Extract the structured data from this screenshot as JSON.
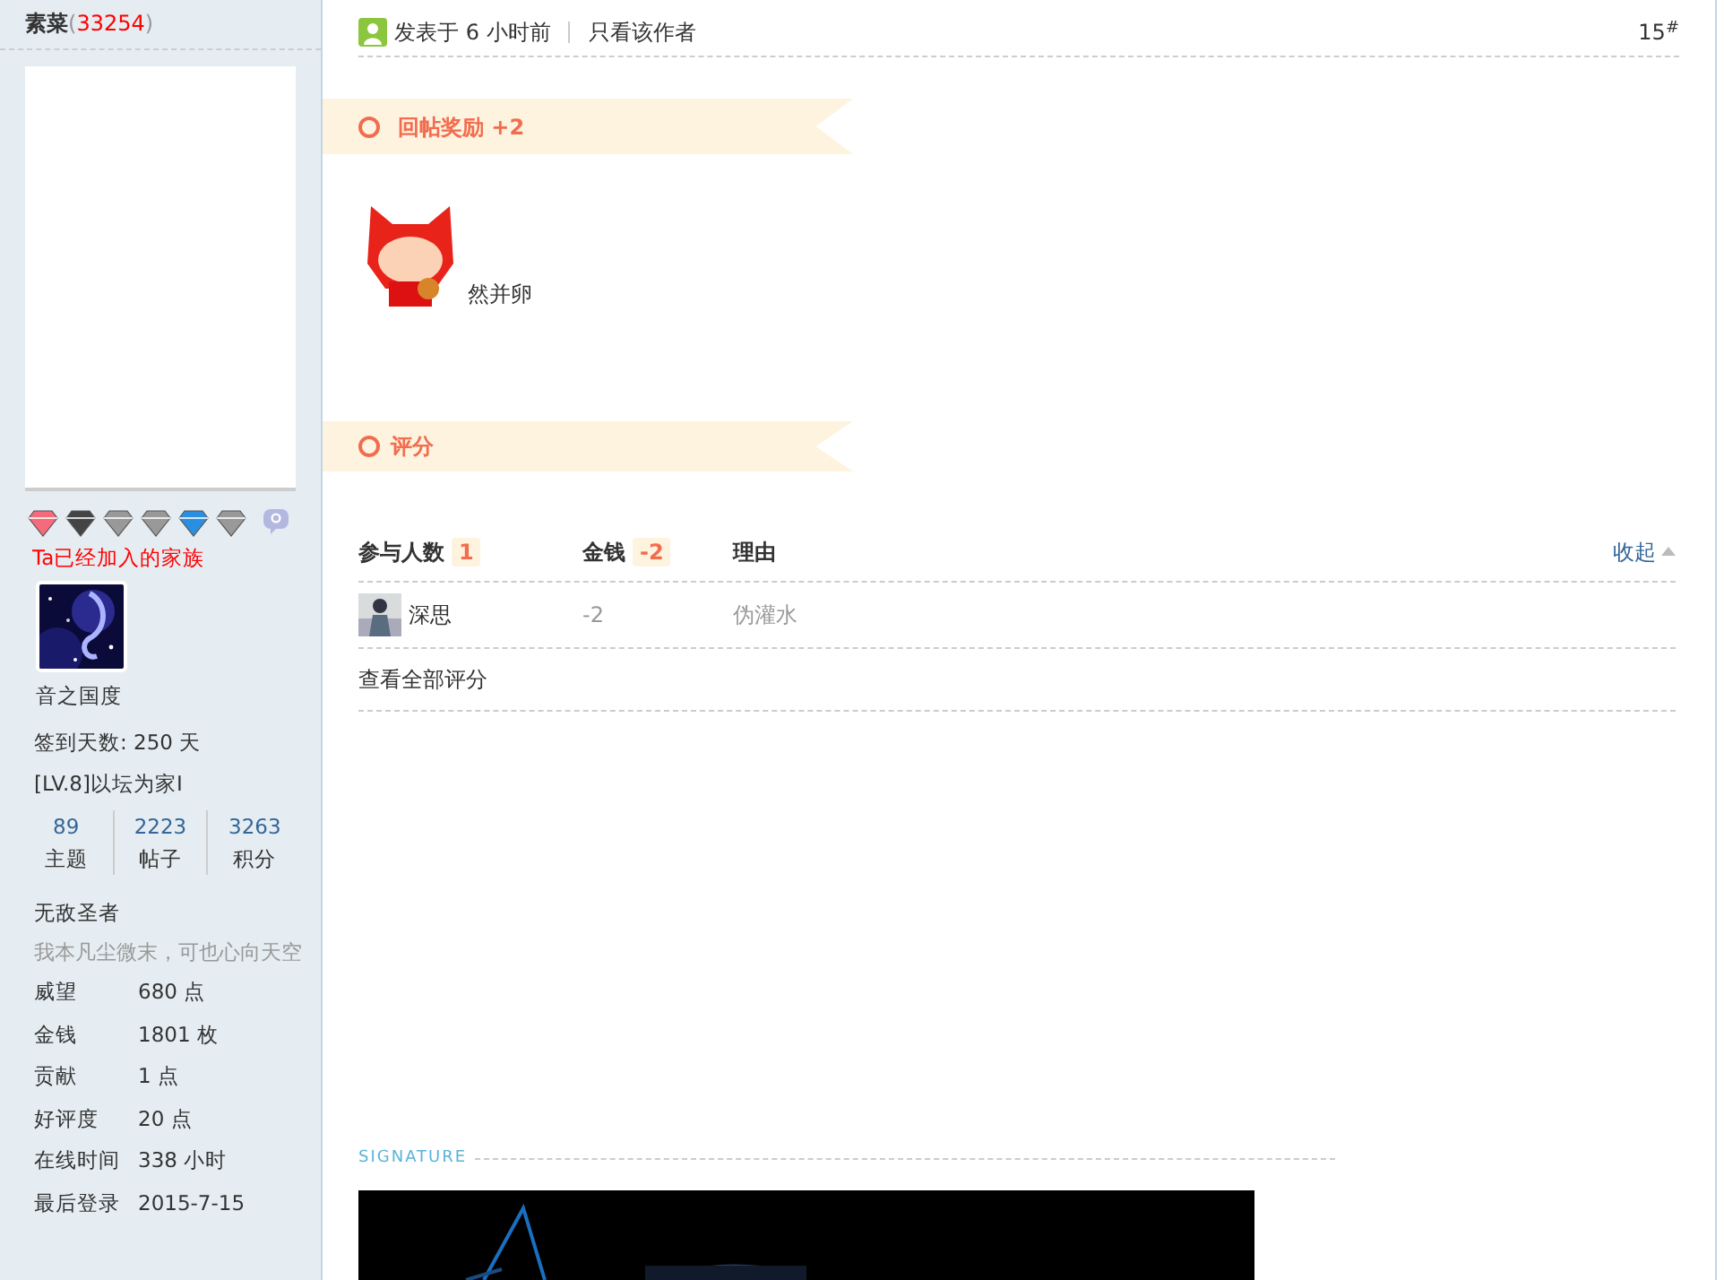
{
  "user": {
    "name": "素菜",
    "count": "33254",
    "brackets": [
      "(",
      ")"
    ]
  },
  "family": {
    "label": "Ta已经加入的家族",
    "name": "音之国度"
  },
  "checkin": "签到天数: 250 天",
  "level": "[LV.8]以坛为家I",
  "stats": [
    {
      "value": "89",
      "label": "主题"
    },
    {
      "value": "2223",
      "label": "帖子"
    },
    {
      "value": "3263",
      "label": "积分"
    }
  ],
  "rank_title": "无敌圣者",
  "motto": "我本凡尘微末，可也心向天空",
  "profile": [
    {
      "label": "威望",
      "value": "680 点"
    },
    {
      "label": "金钱",
      "value": "1801 枚"
    },
    {
      "label": "贡献",
      "value": "1 点"
    },
    {
      "label": "好评度",
      "value": "20 点"
    },
    {
      "label": "在线时间",
      "value": "338 小时"
    },
    {
      "label": "最后登录",
      "value": "2015-7-15"
    }
  ],
  "post": {
    "posted": "发表于 6 小时前",
    "only_author": "只看该作者",
    "floor": "15$^{#}$"
  },
  "reward": {
    "title": "回帖奖励",
    "amount": "+2"
  },
  "message": "然并卵",
  "rating": {
    "title": "评分",
    "columns": [
      {
        "label": "参与人数",
        "count": "1"
      },
      {
        "label": "金钱",
        "count": "-2"
      },
      {
        "label": "理由"
      }
    ],
    "collapse": "收起",
    "rows": [
      {
        "user": "深思",
        "money": "-2",
        "reason": "伪灌水"
      }
    ],
    "view_all": "查看全部评分"
  },
  "signature": {
    "label": "SIGNATURE"
  }
}
